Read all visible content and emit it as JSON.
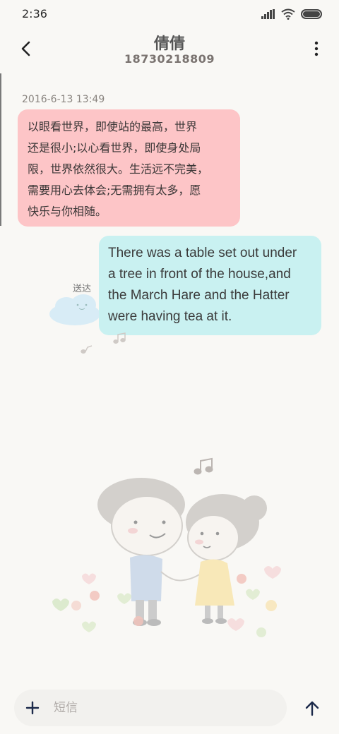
{
  "status_bar": {
    "time": "2:36"
  },
  "header": {
    "name": "倩倩",
    "number": "18730218809"
  },
  "messages": {
    "timestamp": "2016-6-13 13:49",
    "incoming": {
      "lines": [
        "以眼看世界，即使站的最高，世界",
        "还是很小;以心看世界，即使身处局",
        "限，世界依然很大。生活远不完美，",
        "需要用心去体会;无需拥有太多，愿",
        "快乐与你相随。"
      ]
    },
    "outgoing": {
      "lines": [
        "There was a table set out under",
        "a tree in front of the house,and",
        "the March Hare and the Hatter",
        "were having tea at it."
      ],
      "status": "送达"
    }
  },
  "composer": {
    "placeholder": "短信"
  },
  "colors": {
    "incoming_bubble": "#fdc5c7",
    "outgoing_bubble": "#c9f1f1",
    "background": "#f9f8f5"
  },
  "icons": [
    "back-icon",
    "more-icon",
    "signal-icon",
    "wifi-icon",
    "battery-icon",
    "plus-icon",
    "send-icon"
  ]
}
